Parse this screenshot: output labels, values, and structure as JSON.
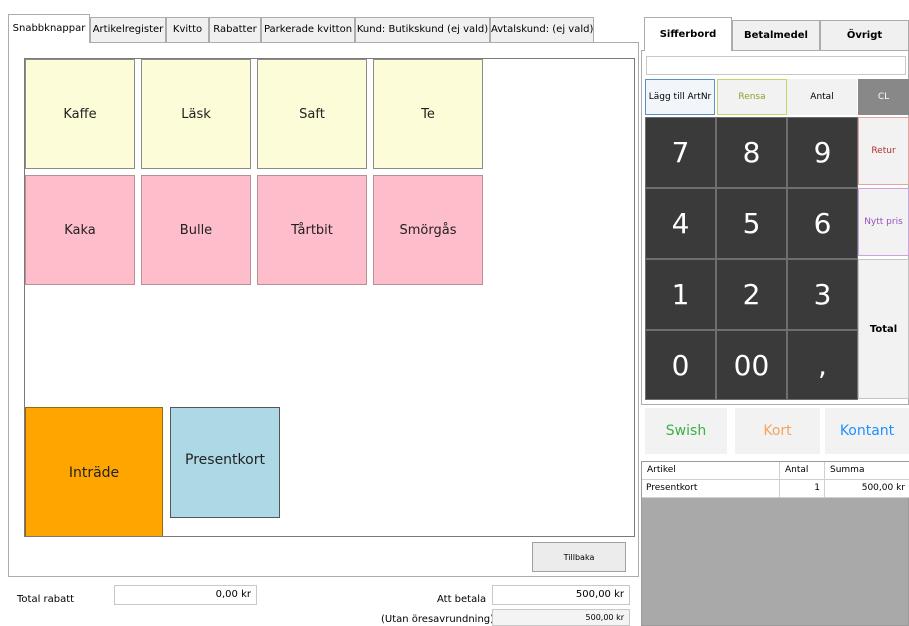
{
  "tabs": [
    {
      "label": "Snabbknappar",
      "active": true
    },
    {
      "label": "Artikelregister"
    },
    {
      "label": "Kvitto"
    },
    {
      "label": "Rabatter"
    },
    {
      "label": "Parkerade kvitton"
    },
    {
      "label": "Kund: Butikskund (ej vald)"
    },
    {
      "label": "Avtalskund: (ej vald)"
    }
  ],
  "quick_buttons": [
    {
      "label": "Kaffe",
      "color": "#fdfcd9"
    },
    {
      "label": "Läsk",
      "color": "#fdfcd9"
    },
    {
      "label": "Saft",
      "color": "#fdfcd9"
    },
    {
      "label": "Te",
      "color": "#fdfcd9"
    },
    {
      "label": "Kaka",
      "color": "#fdbdca"
    },
    {
      "label": "Bulle",
      "color": "#fdbdca"
    },
    {
      "label": "Tårtbit",
      "color": "#fdbdca"
    },
    {
      "label": "Smörgås",
      "color": "#fdbdca"
    }
  ],
  "big_buttons": {
    "entry": {
      "label": "Inträde",
      "color": "#ffa500"
    },
    "giftcard": {
      "label": "Presentkort",
      "color": "#add8e6"
    }
  },
  "back_button": "Tillbaka",
  "totals": {
    "discount_label": "Total rabatt",
    "discount_value": "0,00 kr",
    "to_pay_label": "Att betala",
    "to_pay_value": "500,00 kr",
    "unrounded_label": "(Utan öresavrundning)",
    "unrounded_value": "500,00 kr"
  },
  "right_tabs": [
    {
      "label": "Sifferbord",
      "active": true
    },
    {
      "label": "Betalmedel"
    },
    {
      "label": "Övrigt"
    }
  ],
  "numpad": {
    "display_value": "",
    "add_artnr": "Lägg till ArtNr",
    "clear": "Rensa",
    "quantity": "Antal",
    "cl": "CL",
    "return": "Retur",
    "new_price": "Nytt pris",
    "total": "Total",
    "keys": {
      "k7": "7",
      "k8": "8",
      "k9": "9",
      "k4": "4",
      "k5": "5",
      "k6": "6",
      "k1": "1",
      "k2": "2",
      "k3": "3",
      "k0": "0",
      "k00": "00",
      "kcomma": ","
    }
  },
  "payment": {
    "swish": "Swish",
    "card": "Kort",
    "cash": "Kontant",
    "colors": {
      "swish": "#3cb043",
      "card": "#f4a460",
      "cash": "#1e90ff"
    }
  },
  "article_grid": {
    "columns": [
      "Artikel",
      "Antal",
      "Summa"
    ],
    "rows": [
      {
        "artikel": "Presentkort",
        "antal": "1",
        "summa": "500,00 kr"
      }
    ]
  }
}
